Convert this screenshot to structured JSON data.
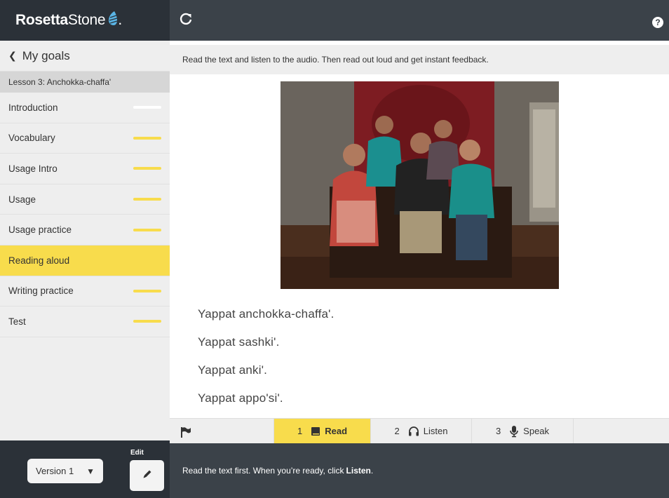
{
  "brand": {
    "bold": "Rosetta",
    "thin": "Stone",
    "suffix": "."
  },
  "sidebar": {
    "back_label": "My goals",
    "lesson_title": "Lesson 3: Anchokka-chaffa'",
    "items": [
      {
        "label": "Introduction",
        "progress_color": "#ffffff",
        "active": false
      },
      {
        "label": "Vocabulary",
        "progress_color": "#f8dc4c",
        "active": false
      },
      {
        "label": "Usage Intro",
        "progress_color": "#f8dc4c",
        "active": false
      },
      {
        "label": "Usage",
        "progress_color": "#f8dc4c",
        "active": false
      },
      {
        "label": "Usage practice",
        "progress_color": "#f8dc4c",
        "active": false
      },
      {
        "label": "Reading aloud",
        "progress_color": "",
        "active": true
      },
      {
        "label": "Writing practice",
        "progress_color": "#f8dc4c",
        "active": false
      },
      {
        "label": "Test",
        "progress_color": "#f8dc4c",
        "active": false
      }
    ],
    "version_value": "Version 1",
    "edit_label": "Edit"
  },
  "topbar": {
    "help_glyph": "?"
  },
  "main": {
    "instruction": "Read the text and listen to the audio. Then read out loud and get instant feedback.",
    "sentences": [
      "Yappat anchokka-chaffa'.",
      "Yappat sashki'.",
      "Yappat anki'.",
      "Yappat appo'si'."
    ]
  },
  "steps": [
    {
      "num": "1",
      "label": "Read",
      "icon": "book-icon",
      "active": true
    },
    {
      "num": "2",
      "label": "Listen",
      "icon": "headphones-icon",
      "active": false
    },
    {
      "num": "3",
      "label": "Speak",
      "icon": "microphone-icon",
      "active": false
    }
  ],
  "bottombar": {
    "text": "Read the text first. When you’re ready, click",
    "bold": "Listen",
    "end": "."
  },
  "colors": {
    "accent": "#f8dc4c",
    "dark": "#2b3138",
    "topbar": "#3b4249",
    "panel": "#eeeeee"
  }
}
